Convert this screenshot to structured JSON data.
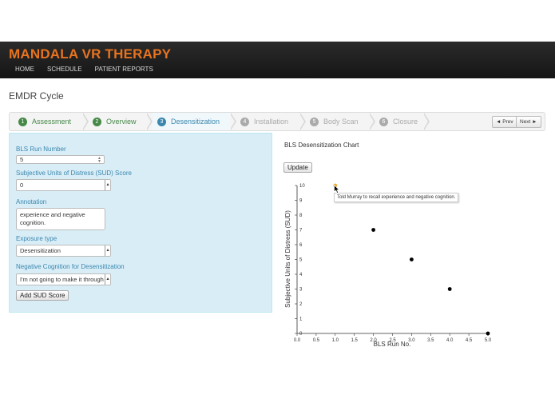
{
  "app": {
    "title": "MANDALA VR THERAPY"
  },
  "nav": [
    {
      "label": "HOME"
    },
    {
      "label": "SCHEDULE"
    },
    {
      "label": "PATIENT REPORTS"
    }
  ],
  "page": {
    "title": "EMDR Cycle"
  },
  "wizard": {
    "steps": [
      {
        "num": "1",
        "label": "Assessment",
        "state": "complete"
      },
      {
        "num": "2",
        "label": "Overview",
        "state": "complete"
      },
      {
        "num": "3",
        "label": "Desensitization",
        "state": "active"
      },
      {
        "num": "4",
        "label": "Installation",
        "state": "todo"
      },
      {
        "num": "5",
        "label": "Body Scan",
        "state": "todo"
      },
      {
        "num": "6",
        "label": "Closure",
        "state": "todo"
      }
    ],
    "prev_label": "◄ Prev",
    "next_label": "Next ►"
  },
  "form": {
    "bls_label": "BLS Run Number",
    "bls_value": "5",
    "sud_label": "Subjective Units of Distress (SUD) Score",
    "sud_value": "0",
    "annotation_label": "Annotation",
    "annotation_value": "experience and negative cognition.",
    "exposure_label": "Exposure type",
    "exposure_value": "Desensitization",
    "negcog_label": "Negative Cognition for Desensitization",
    "negcog_value": "I'm not going to make it through",
    "add_button": "Add SUD Score"
  },
  "chart_panel": {
    "title": "BLS Desensitization Chart",
    "update_button": "Update",
    "tooltip": "Told Murray to recall experience and negative cognition."
  },
  "colors": {
    "brand": "#e8731f",
    "complete": "#468847",
    "active": "#3a87ad",
    "highlight_point": "#f0a830",
    "panel_bg": "#d9edf7"
  },
  "chart_data": {
    "type": "scatter",
    "title": "",
    "xlabel": "BLS Run No.",
    "ylabel": "Subjective Units of Distress (SUD)",
    "xlim": [
      0,
      5
    ],
    "ylim": [
      0,
      10
    ],
    "xticks": [
      "0.0",
      "0.5",
      "1.0",
      "1.5",
      "2.0",
      "2.5",
      "3.0",
      "3.5",
      "4.0",
      "4.5",
      "5.0"
    ],
    "yticks": [
      "0",
      "1",
      "2",
      "3",
      "4",
      "5",
      "6",
      "7",
      "8",
      "9",
      "10"
    ],
    "points": [
      {
        "x": 1,
        "y": 10,
        "highlighted": true
      },
      {
        "x": 2,
        "y": 7
      },
      {
        "x": 3,
        "y": 5
      },
      {
        "x": 4,
        "y": 3
      },
      {
        "x": 5,
        "y": 0
      }
    ],
    "grid": false
  }
}
